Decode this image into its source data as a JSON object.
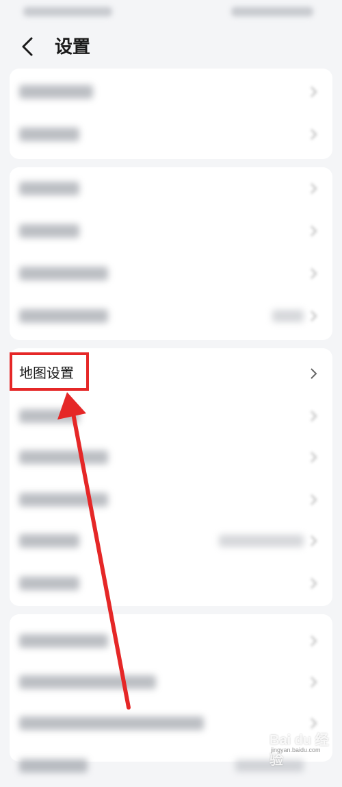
{
  "header": {
    "title": "设置",
    "back_icon": "chevron-left-icon"
  },
  "highlighted_item": {
    "label": "地图设置"
  },
  "watermark": {
    "brand": "Bai du 经验",
    "url": "jingyan.baidu.com"
  },
  "colors": {
    "background": "#f4f5f7",
    "card": "#ffffff",
    "highlight": "#e52727",
    "chevron": "#666666"
  }
}
